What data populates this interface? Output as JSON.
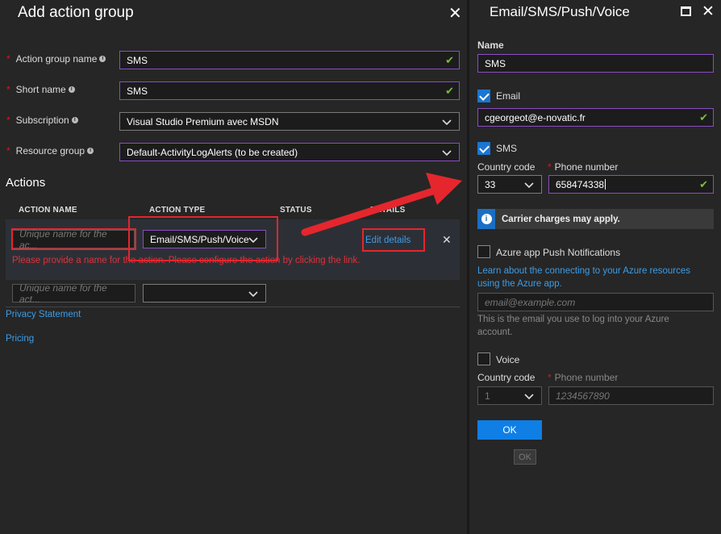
{
  "left_blade": {
    "title": "Add action group",
    "fields": {
      "action_group_name": {
        "label": "Action group name",
        "value": "SMS"
      },
      "short_name": {
        "label": "Short name",
        "value": "SMS"
      },
      "subscription": {
        "label": "Subscription",
        "value": "Visual Studio Premium avec MSDN"
      },
      "resource_group": {
        "label": "Resource group",
        "value": "Default-ActivityLogAlerts (to be created)"
      }
    },
    "actions_heading": "Actions",
    "columns": [
      "ACTION NAME",
      "ACTION TYPE",
      "STATUS",
      "DETAILS"
    ],
    "row1": {
      "name_placeholder": "Unique name for the ac...",
      "type": "Email/SMS/Push/Voice",
      "details_link": "Edit details",
      "error": "Please provide a name for the action. Please configure the action by clicking the link."
    },
    "row2": {
      "name_placeholder": "Unique name for the act...",
      "type": ""
    },
    "privacy_link": "Privacy Statement",
    "pricing_link": "Pricing"
  },
  "right_blade": {
    "title": "Email/SMS/Push/Voice",
    "name_label": "Name",
    "name_value": "SMS",
    "email": {
      "label": "Email",
      "checked": true,
      "value": "cgeorgeot@e-novatic.fr"
    },
    "sms": {
      "label": "SMS",
      "checked": true,
      "country_code_label": "Country code",
      "country_code_value": "33",
      "phone_label": "Phone number",
      "phone_value": "658474338"
    },
    "info_banner": "Carrier charges may apply.",
    "push": {
      "label": "Azure app Push Notifications",
      "checked": false,
      "learn_link": "Learn about the connecting to your Azure resources using the Azure app.",
      "email_placeholder": "email@example.com",
      "help_text": "This is the email you use to log into your Azure account."
    },
    "voice": {
      "label": "Voice",
      "checked": false,
      "country_code_label": "Country code",
      "country_code_value": "1",
      "phone_label": "Phone number",
      "phone_placeholder": "1234567890"
    },
    "ok_label": "OK",
    "ok_secondary_label": "OK"
  },
  "colors": {
    "accent_blue": "#0f7fe6",
    "focus_purple": "#8a4dc4",
    "error_red": "#e0303a",
    "valid_green": "#7bbf3b",
    "annotation_red": "#e5262d"
  }
}
